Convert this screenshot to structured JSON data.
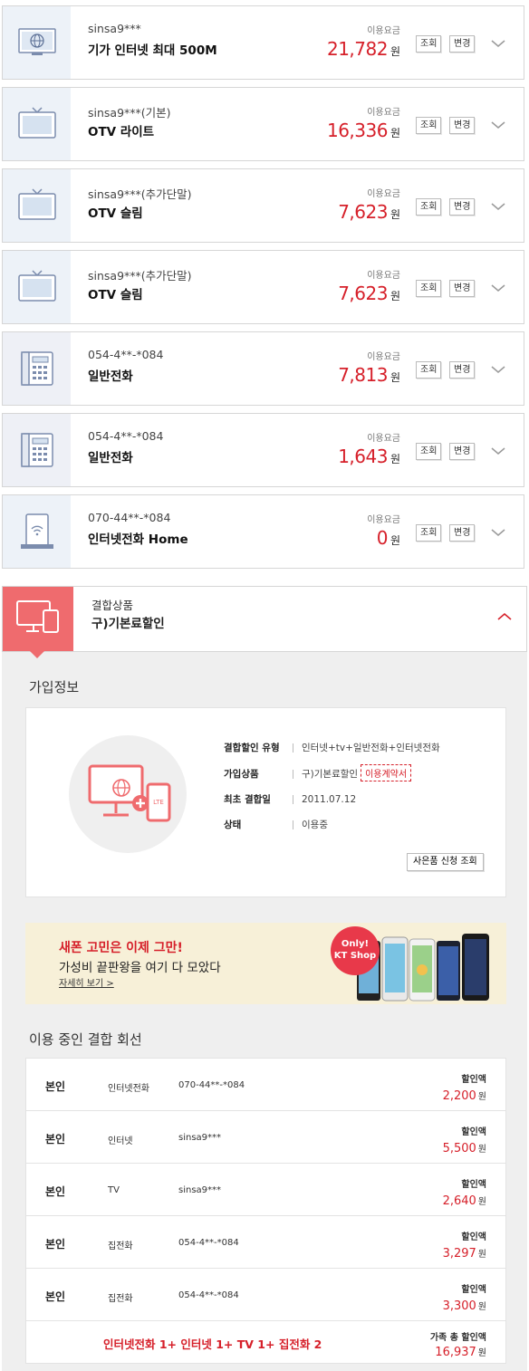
{
  "services": [
    {
      "id": "sinsa9***",
      "name": "기가 인터넷 최대 500M",
      "fee_label": "이용요금",
      "amount": "21,782",
      "unit": "원",
      "btn_view": "조회",
      "btn_change": "변경",
      "icon": "monitor-globe-icon"
    },
    {
      "id": "sinsa9***(기본)",
      "name": "OTV 라이트",
      "fee_label": "이용요금",
      "amount": "16,336",
      "unit": "원",
      "btn_view": "조회",
      "btn_change": "변경",
      "icon": "tv-icon"
    },
    {
      "id": "sinsa9***(추가단말)",
      "name": "OTV 슬림",
      "fee_label": "이용요금",
      "amount": "7,623",
      "unit": "원",
      "btn_view": "조회",
      "btn_change": "변경",
      "icon": "tv-icon"
    },
    {
      "id": "sinsa9***(추가단말)",
      "name": "OTV 슬림",
      "fee_label": "이용요금",
      "amount": "7,623",
      "unit": "원",
      "btn_view": "조회",
      "btn_change": "변경",
      "icon": "tv-icon"
    },
    {
      "id": "054-4**-*084",
      "name": "일반전화",
      "fee_label": "이용요금",
      "amount": "7,813",
      "unit": "원",
      "btn_view": "조회",
      "btn_change": "변경",
      "icon": "desk-phone-icon"
    },
    {
      "id": "054-4**-*084",
      "name": "일반전화",
      "fee_label": "이용요금",
      "amount": "1,643",
      "unit": "원",
      "btn_view": "조회",
      "btn_change": "변경",
      "icon": "desk-phone-icon"
    },
    {
      "id": "070-44**-*084",
      "name": "인터넷전화 Home",
      "fee_label": "이용요금",
      "amount": "0",
      "unit": "원",
      "btn_view": "조회",
      "btn_change": "변경",
      "icon": "wifi-phone-icon"
    }
  ],
  "combo": {
    "label": "결합상품",
    "name": "구)기본료할인"
  },
  "join_info": {
    "title": "가입정보",
    "rows": [
      {
        "key": "결합할인 유형",
        "value": "인터넷+tv+일반전화+인터넷전화"
      },
      {
        "key": "가입상품",
        "value": "구)기본료할인",
        "link": "이용계약서"
      },
      {
        "key": "최초 결합일",
        "value": "2011.07.12"
      },
      {
        "key": "상태",
        "value": "이용중"
      }
    ],
    "gift_button": "사은품 신청 조회",
    "badge": "LTE"
  },
  "banner": {
    "title": "새폰 고민은 이제 그만!",
    "subtitle": "가성비 끝판왕을 여기 다 모았다",
    "more": "자세히 보기 >",
    "badge_line1": "Only!",
    "badge_line2": "KT Shop"
  },
  "lines": {
    "title": "이용 중인 결합 회선",
    "discount_label": "할인액",
    "unit": "원",
    "rows": [
      {
        "owner": "본인",
        "service": "인터넷전화",
        "line": "070-44**-*084",
        "amount": "2,200"
      },
      {
        "owner": "본인",
        "service": "인터넷",
        "line": "sinsa9***",
        "amount": "5,500"
      },
      {
        "owner": "본인",
        "service": "TV",
        "line": "sinsa9***",
        "amount": "2,640"
      },
      {
        "owner": "본인",
        "service": "집전화",
        "line": "054-4**-*084",
        "amount": "3,297"
      },
      {
        "owner": "본인",
        "service": "집전화",
        "line": "054-4**-*084",
        "amount": "3,300"
      }
    ],
    "total_text": "인터넷전화 1+ 인터넷 1+ TV 1+ 집전화 2",
    "total_label": "가족 총 할인액",
    "total_amount": "16,937"
  },
  "colors": {
    "accent": "#d6202a",
    "combo": "#ef6b6e",
    "banner_bg": "#f7f0d8"
  }
}
